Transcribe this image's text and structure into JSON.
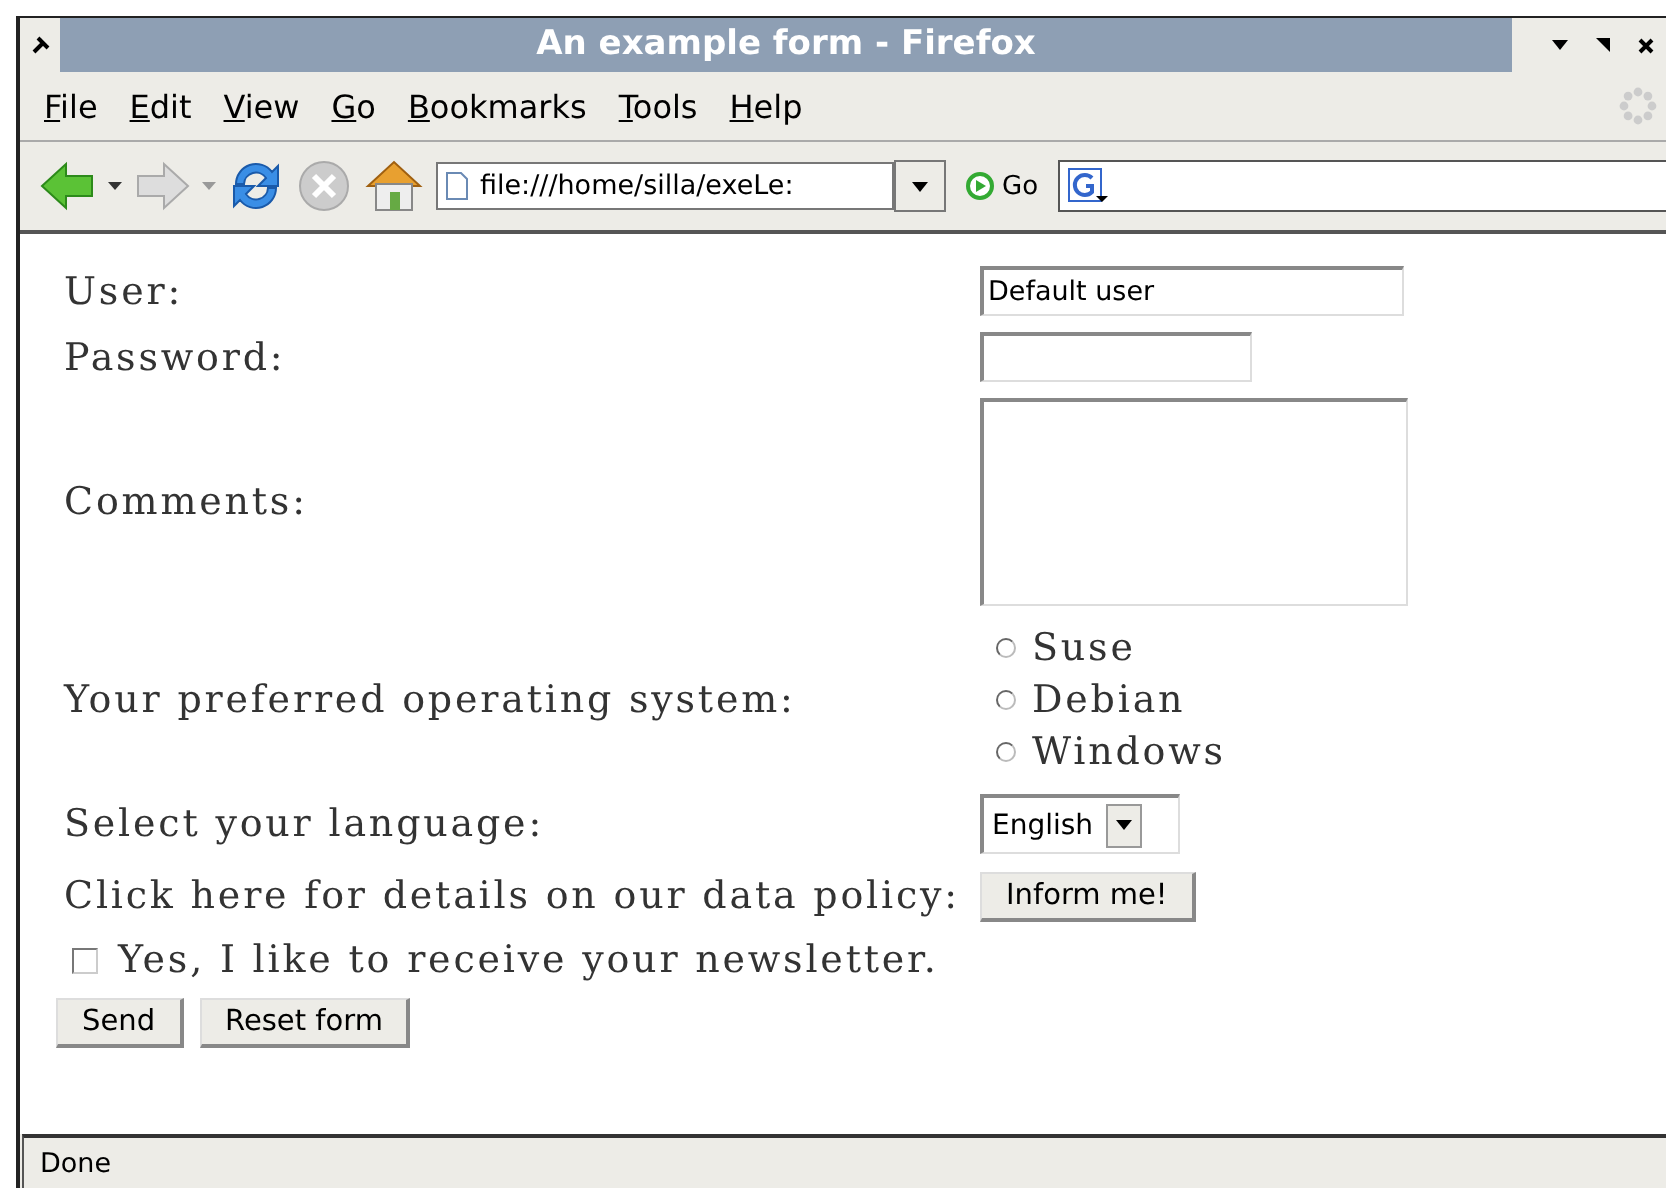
{
  "window": {
    "title": "An example form - Firefox"
  },
  "menu": [
    "File",
    "Edit",
    "View",
    "Go",
    "Bookmarks",
    "Tools",
    "Help"
  ],
  "toolbar": {
    "address": "file:///home/silla/exeLe:",
    "go": "Go"
  },
  "form": {
    "rows": [
      {
        "kind": "text",
        "label": "User:",
        "value": "Default user"
      },
      {
        "kind": "password",
        "label": "Password:"
      },
      {
        "kind": "textarea",
        "label": "Comments:"
      },
      {
        "kind": "radio",
        "label": "Your preferred operating system:",
        "options": [
          {
            "label": "Suse",
            "selected": false
          },
          {
            "label": "Debian",
            "selected": false
          },
          {
            "label": "Windows",
            "selected": false
          }
        ]
      },
      {
        "kind": "select",
        "label": "Select your language:",
        "value": "English"
      },
      {
        "kind": "button",
        "label": "Click here for details on our data policy:",
        "button": "Inform me!"
      }
    ],
    "newsletter": {
      "label": "Yes, I like to receive your newsletter.",
      "checked": false
    },
    "buttons": [
      "Send",
      "Reset form"
    ]
  },
  "status_bar": "Done"
}
